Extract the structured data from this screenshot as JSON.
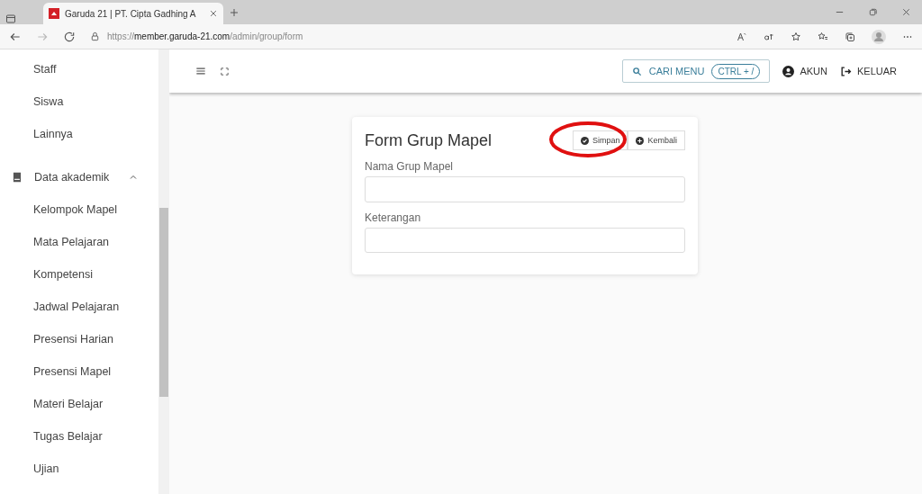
{
  "browser": {
    "tab_title": "Garuda 21 | PT. Cipta Gadhing A",
    "url_scheme": "https://",
    "url_host": "member.garuda-21.com",
    "url_path": "/admin/group/form"
  },
  "sidebar": {
    "items": [
      {
        "label": "Staff"
      },
      {
        "label": "Siswa"
      },
      {
        "label": "Lainnya"
      },
      {
        "label": "Data akademik",
        "expanded": true,
        "children": [
          {
            "label": "Kelompok Mapel"
          },
          {
            "label": "Mata Pelajaran"
          },
          {
            "label": "Kompetensi"
          },
          {
            "label": "Jadwal Pelajaran"
          },
          {
            "label": "Presensi Harian"
          },
          {
            "label": "Presensi Mapel"
          },
          {
            "label": "Materi Belajar"
          },
          {
            "label": "Tugas Belajar"
          },
          {
            "label": "Ujian"
          }
        ]
      }
    ]
  },
  "header": {
    "search_label": "CARI MENU",
    "shortcut": "CTRL + /",
    "account": "AKUN",
    "logout": "KELUAR"
  },
  "form": {
    "title": "Form Grup Mapel",
    "buttons": [
      {
        "label": "Simpan",
        "kind": "save",
        "highlighted": true
      },
      {
        "label": "Kembali",
        "kind": "back",
        "highlighted": false
      }
    ],
    "fields": [
      {
        "label": "Nama Grup Mapel"
      },
      {
        "label": "Keterangan"
      }
    ]
  }
}
